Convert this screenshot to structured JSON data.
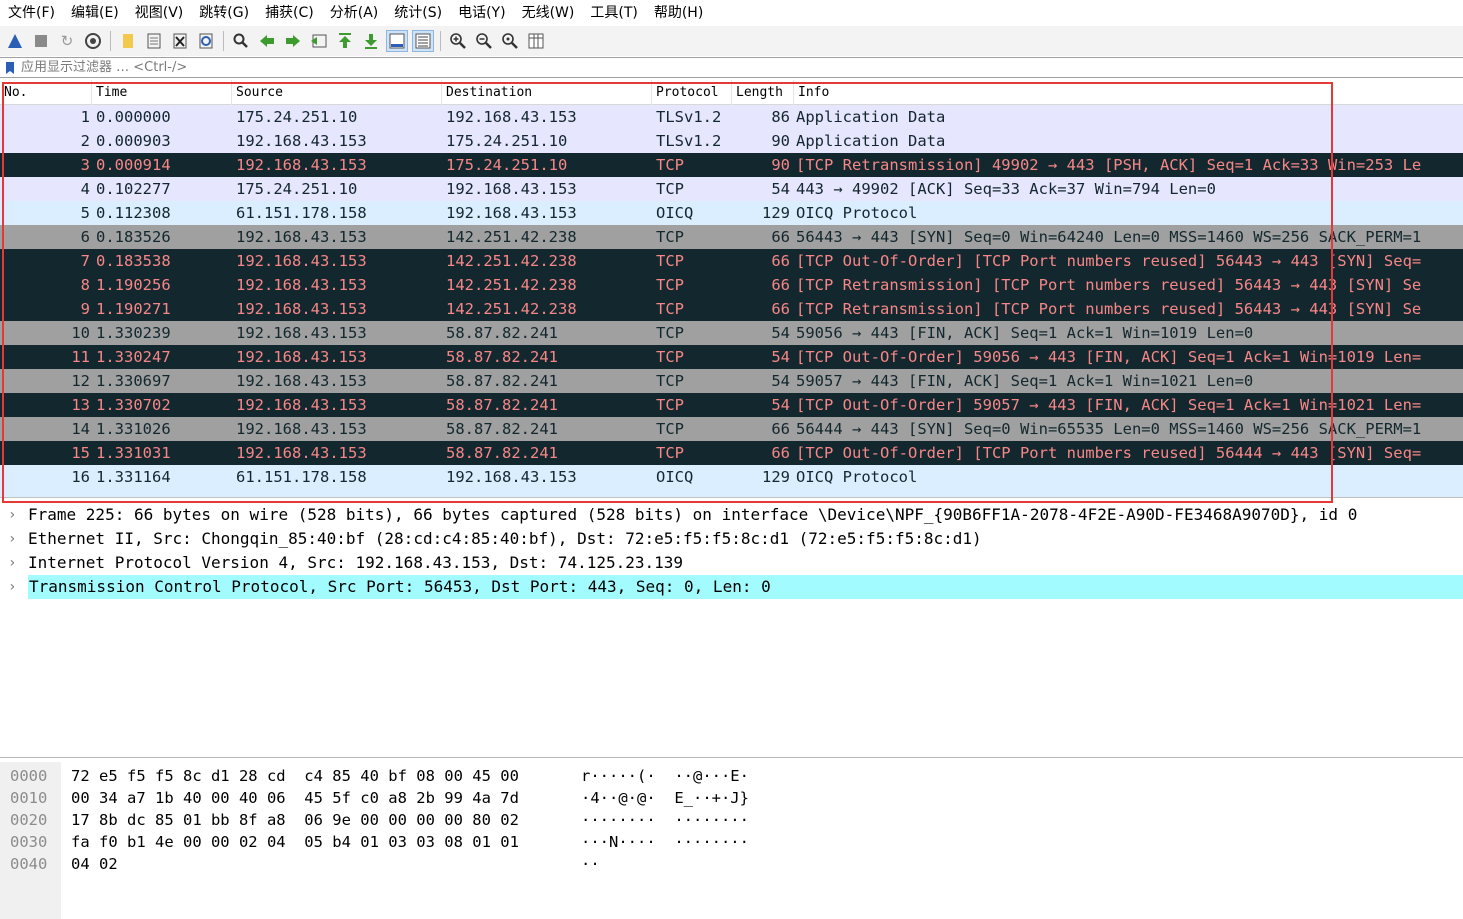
{
  "menu": [
    "文件(F)",
    "编辑(E)",
    "视图(V)",
    "跳转(G)",
    "捕获(C)",
    "分析(A)",
    "统计(S)",
    "电话(Y)",
    "无线(W)",
    "工具(T)",
    "帮助(H)"
  ],
  "toolbar": {
    "icons": [
      "shark-fin-start-icon",
      "stop-icon",
      "restart-icon",
      "capture-options-icon",
      "open-file-icon",
      "save-file-icon",
      "close-file-icon",
      "reload-icon",
      "find-packet-icon",
      "go-back-icon",
      "go-forward-icon",
      "go-to-packet-icon",
      "go-first-icon",
      "go-last-icon",
      "auto-scroll-icon",
      "colorize-icon",
      "zoom-in-icon",
      "zoom-out-icon",
      "zoom-normal-icon",
      "resize-columns-icon"
    ]
  },
  "filter": {
    "placeholder": "应用显示过滤器 … <Ctrl-/>"
  },
  "columns": [
    "No.",
    "Time",
    "Source",
    "Destination",
    "Protocol",
    "Length",
    "Info"
  ],
  "packets": [
    {
      "no": "1",
      "time": "0.000000",
      "src": "175.24.251.10",
      "dst": "192.168.43.153",
      "proto": "TLSv1.2",
      "len": "86",
      "info": "Application Data",
      "style": "lavender"
    },
    {
      "no": "2",
      "time": "0.000903",
      "src": "192.168.43.153",
      "dst": "175.24.251.10",
      "proto": "TLSv1.2",
      "len": "90",
      "info": "Application Data",
      "style": "lavender"
    },
    {
      "no": "3",
      "time": "0.000914",
      "src": "192.168.43.153",
      "dst": "175.24.251.10",
      "proto": "TCP",
      "len": "90",
      "info": "[TCP Retransmission] 49902 → 443 [PSH, ACK] Seq=1 Ack=33 Win=253 Le",
      "style": "dark"
    },
    {
      "no": "4",
      "time": "0.102277",
      "src": "175.24.251.10",
      "dst": "192.168.43.153",
      "proto": "TCP",
      "len": "54",
      "info": "443 → 49902 [ACK] Seq=33 Ack=37 Win=794 Len=0",
      "style": "lavender"
    },
    {
      "no": "5",
      "time": "0.112308",
      "src": "61.151.178.158",
      "dst": "192.168.43.153",
      "proto": "OICQ",
      "len": "129",
      "info": "OICQ Protocol",
      "style": "lightblue"
    },
    {
      "no": "6",
      "time": "0.183526",
      "src": "192.168.43.153",
      "dst": "142.251.42.238",
      "proto": "TCP",
      "len": "66",
      "info": "56443 → 443 [SYN] Seq=0 Win=64240 Len=0 MSS=1460 WS=256 SACK_PERM=1",
      "style": "gray"
    },
    {
      "no": "7",
      "time": "0.183538",
      "src": "192.168.43.153",
      "dst": "142.251.42.238",
      "proto": "TCP",
      "len": "66",
      "info": "[TCP Out-Of-Order] [TCP Port numbers reused] 56443 → 443 [SYN] Seq=",
      "style": "dark"
    },
    {
      "no": "8",
      "time": "1.190256",
      "src": "192.168.43.153",
      "dst": "142.251.42.238",
      "proto": "TCP",
      "len": "66",
      "info": "[TCP Retransmission] [TCP Port numbers reused] 56443 → 443 [SYN] Se",
      "style": "dark"
    },
    {
      "no": "9",
      "time": "1.190271",
      "src": "192.168.43.153",
      "dst": "142.251.42.238",
      "proto": "TCP",
      "len": "66",
      "info": "[TCP Retransmission] [TCP Port numbers reused] 56443 → 443 [SYN] Se",
      "style": "dark"
    },
    {
      "no": "10",
      "time": "1.330239",
      "src": "192.168.43.153",
      "dst": "58.87.82.241",
      "proto": "TCP",
      "len": "54",
      "info": "59056 → 443 [FIN, ACK] Seq=1 Ack=1 Win=1019 Len=0",
      "style": "gray"
    },
    {
      "no": "11",
      "time": "1.330247",
      "src": "192.168.43.153",
      "dst": "58.87.82.241",
      "proto": "TCP",
      "len": "54",
      "info": "[TCP Out-Of-Order] 59056 → 443 [FIN, ACK] Seq=1 Ack=1 Win=1019 Len=",
      "style": "dark"
    },
    {
      "no": "12",
      "time": "1.330697",
      "src": "192.168.43.153",
      "dst": "58.87.82.241",
      "proto": "TCP",
      "len": "54",
      "info": "59057 → 443 [FIN, ACK] Seq=1 Ack=1 Win=1021 Len=0",
      "style": "gray"
    },
    {
      "no": "13",
      "time": "1.330702",
      "src": "192.168.43.153",
      "dst": "58.87.82.241",
      "proto": "TCP",
      "len": "54",
      "info": "[TCP Out-Of-Order] 59057 → 443 [FIN, ACK] Seq=1 Ack=1 Win=1021 Len=",
      "style": "dark"
    },
    {
      "no": "14",
      "time": "1.331026",
      "src": "192.168.43.153",
      "dst": "58.87.82.241",
      "proto": "TCP",
      "len": "66",
      "info": "56444 → 443 [SYN] Seq=0 Win=65535 Len=0 MSS=1460 WS=256 SACK_PERM=1",
      "style": "gray"
    },
    {
      "no": "15",
      "time": "1.331031",
      "src": "192.168.43.153",
      "dst": "58.87.82.241",
      "proto": "TCP",
      "len": "66",
      "info": "[TCP Out-Of-Order] [TCP Port numbers reused] 56444 → 443 [SYN] Seq=",
      "style": "dark"
    },
    {
      "no": "16",
      "time": "1.331164",
      "src": "61.151.178.158",
      "dst": "192.168.43.153",
      "proto": "OICQ",
      "len": "129",
      "info": "OICQ Protocol",
      "style": "lightblue"
    }
  ],
  "details": [
    {
      "text": "Frame 225: 66 bytes on wire (528 bits), 66 bytes captured (528 bits) on interface \\Device\\NPF_{90B6FF1A-2078-4F2E-A90D-FE3468A9070D}, id 0",
      "selected": false
    },
    {
      "text": "Ethernet II, Src: Chongqin_85:40:bf (28:cd:c4:85:40:bf), Dst: 72:e5:f5:f5:8c:d1 (72:e5:f5:f5:8c:d1)",
      "selected": false
    },
    {
      "text": "Internet Protocol Version 4, Src: 192.168.43.153, Dst: 74.125.23.139",
      "selected": false
    },
    {
      "text": "Transmission Control Protocol, Src Port: 56453, Dst Port: 443, Seq: 0, Len: 0",
      "selected": true
    }
  ],
  "bytes": [
    {
      "offset": "0000",
      "hex": "72 e5 f5 f5 8c d1 28 cd  c4 85 40 bf 08 00 45 00",
      "ascii": "r·····(·  ··@···E·"
    },
    {
      "offset": "0010",
      "hex": "00 34 a7 1b 40 00 40 06  45 5f c0 a8 2b 99 4a 7d",
      "ascii": "·4··@·@·  E_··+·J}"
    },
    {
      "offset": "0020",
      "hex": "17 8b dc 85 01 bb 8f a8  06 9e 00 00 00 00 80 02",
      "ascii": "········  ········"
    },
    {
      "offset": "0030",
      "hex": "fa f0 b1 4e 00 00 02 04  05 b4 01 03 03 08 01 01",
      "ascii": "···N····  ········"
    },
    {
      "offset": "0040",
      "hex": "04 02",
      "ascii": "··"
    }
  ],
  "colors": {
    "highlight_box": "#e53935",
    "selected_detail": "#a2fcff",
    "dark_row_text": "#f78787"
  }
}
